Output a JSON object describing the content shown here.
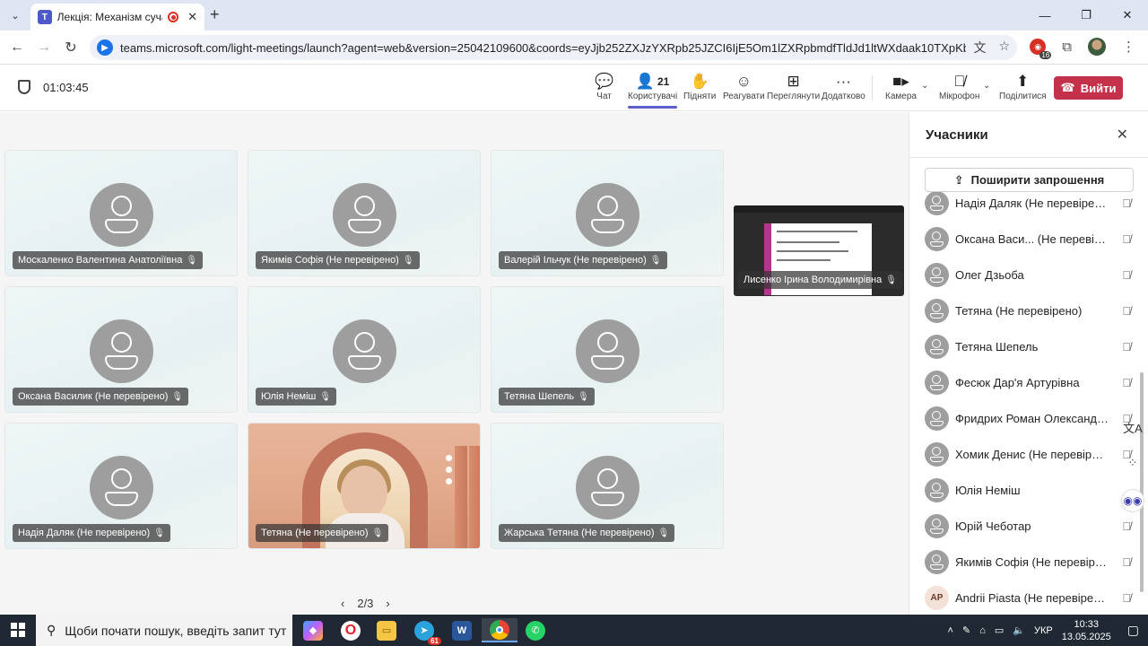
{
  "browser": {
    "tab_title": "Лекція: Механізм сучасної",
    "url": "teams.microsoft.com/light-meetings/launch?agent=web&version=25042109600&coords=eyJjb252ZXJzYXRpb25JZCI6IjE5Om1lZXRpbmdfTldJd1ltWXdaak10TXpKbFppMDBZemcyTF...",
    "ext_badge": "16"
  },
  "meeting": {
    "timer": "01:03:45",
    "people_count": "21",
    "tools": {
      "chat": "Чат",
      "people": "Користувачі",
      "raise": "Підняти",
      "react": "Реагувати",
      "view": "Переглянути",
      "more": "Додатково",
      "camera": "Камера",
      "mic": "Мікрофон",
      "share": "Поділитися"
    },
    "leave_label": "Вийти"
  },
  "stage": {
    "tiles": [
      {
        "name": "Москаленко Валентина Анатоліївна"
      },
      {
        "name": "Якимів Софія (Не перевірено)"
      },
      {
        "name": "Валерій Ільчук (Не перевірено)"
      },
      {
        "name": "Оксана Василик (Не перевірено)"
      },
      {
        "name": "Юлія Неміш"
      },
      {
        "name": "Тетяна Шепель"
      },
      {
        "name": "Надія Даляк (Не перевірено)"
      },
      {
        "name": "Тетяна (Не перевірено)"
      },
      {
        "name": "Жарська Тетяна (Не перевірено)"
      }
    ],
    "share_name": "Лисенко Ірина Володимирівна",
    "pager": "2/3"
  },
  "panel": {
    "title": "Учасники",
    "invite_label": "Поширити запрошення",
    "participants": [
      {
        "name": "Надія Даляк (Не перевірено)"
      },
      {
        "name": "Оксана Васи...  (Не перевірено)"
      },
      {
        "name": "Олег Дзьоба"
      },
      {
        "name": "Тетяна (Не перевірено)"
      },
      {
        "name": "Тетяна Шепель"
      },
      {
        "name": "Фесюк Дар'я Артурівна"
      },
      {
        "name": "Фридрих Роман Олександрович"
      },
      {
        "name": "Хомик Денис (Не перевірено)"
      },
      {
        "name": "Юлія Неміш"
      },
      {
        "name": "Юрій Чеботар"
      },
      {
        "name": "Якимів Софія (Не перевірено)"
      },
      {
        "name": "Andrii Piasta (Не перевірено)",
        "initials": "AP"
      }
    ]
  },
  "taskbar": {
    "search_placeholder": "Щоби почати пошук, введіть запит тут",
    "telegram_badge": "61",
    "language": "УКР",
    "time": "10:33",
    "date": "13.05.2025"
  },
  "colors": {
    "accent": "#5b5fc7",
    "leave": "#c4314b",
    "taskbar": "#202833"
  }
}
